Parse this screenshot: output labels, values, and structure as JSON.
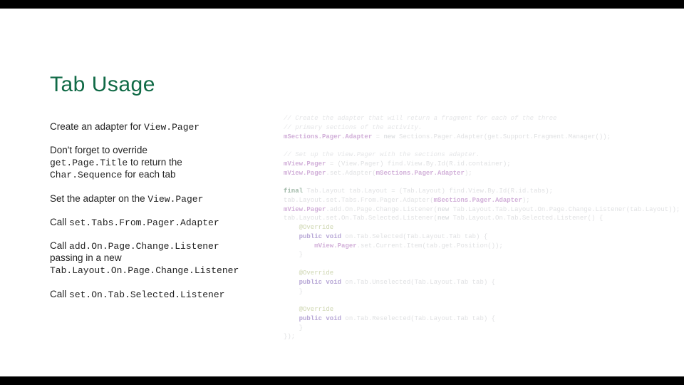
{
  "title": "Tab Usage",
  "bullets": {
    "b1_pre": "Create an adapter for ",
    "b1_code": "View.Pager",
    "b2_l1": "Don't forget to override",
    "b2_code1": "get.Page.Title",
    "b2_mid": " to return the ",
    "b2_code2": "Char.Sequence",
    "b2_end": " for each tab",
    "b3_pre": "Set the adapter on the ",
    "b3_code": "View.Pager",
    "b4_pre": "Call ",
    "b4_code": "set.Tabs.From.Pager.Adapter",
    "b5_pre": "Call ",
    "b5_code": "add.On.Page.Change.Listener",
    "b5_l2": "passing in a new",
    "b5_code2": "Tab.Layout.On.Page.Change.Listener",
    "b6_pre": "Call ",
    "b6_code": "set.On.Tab.Selected.Listener"
  },
  "code": {
    "c01": "// Create the adapter that will return a fragment for each of the three",
    "c02": "// primary sections of the activity.",
    "c03a": "mSections.Pager.Adapter",
    "c03b": " = ",
    "c03c": "new",
    "c03d": " Sections.Pager.Adapter(get.Support.Fragment.Manager());",
    "c04": "",
    "c05": "// Set up the View.Pager with the sections adapter.",
    "c06a": "mView.Pager",
    "c06b": " = (View.Pager) find.View.By.Id(R.id.",
    "c06c": "container",
    "c06d": ");",
    "c07a": "mView.Pager",
    "c07b": ".set.Adapter(",
    "c07c": "mSections.Pager.Adapter",
    "c07d": ");",
    "c08": "",
    "c09a": "final",
    "c09b": " Tab.Layout tab.Layout = (Tab.Layout) find.View.By.Id(R.id.",
    "c09c": "tabs",
    "c09d": ");",
    "c10": "tab.Layout.set.Tabs.From.Pager.Adapter(",
    "c10b": "mSections.Pager.Adapter",
    "c10c": ");",
    "c11a": "mView.Pager",
    "c11b": ".add.On.Page.Change.Listener(",
    "c11c": "new",
    "c11d": " Tab.Layout.Tab.Layout.On.Page.Change.Listener(tab.Layout));",
    "c12": "tab.Layout.set.On.Tab.Selected.Listener(",
    "c12b": "new",
    "c12c": " Tab.Layout.On.Tab.Selected.Listener() {",
    "c13": "    @Override",
    "c14a": "    public void",
    "c14b": " on.Tab.Selected(Tab.Layout.Tab tab) {",
    "c15a": "        mView.Pager",
    "c15b": ".set.Current.Item(tab.get.Position());",
    "c16": "    }",
    "c17": "",
    "c18": "    @Override",
    "c19a": "    public void",
    "c19b": " on.Tab.Unselected(Tab.Layout.Tab tab) {",
    "c20": "    }",
    "c21": "",
    "c22": "    @Override",
    "c23a": "    public void",
    "c23b": " on.Tab.Reselected(Tab.Layout.Tab tab) {",
    "c24": "    }",
    "c25": "});"
  }
}
